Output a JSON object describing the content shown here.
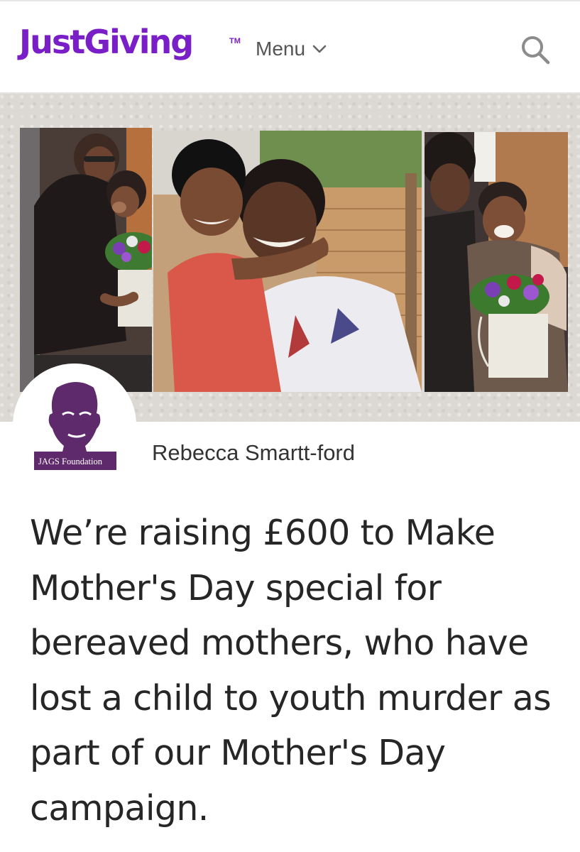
{
  "header": {
    "logo_text": "JustGiving",
    "logo_tm": "TM",
    "menu_label": "Menu",
    "menu_icon": "chevron-down-icon",
    "search_icon": "search-icon",
    "brand_color": "#7a1fc7"
  },
  "banner": {
    "photos": [
      {
        "description_id": "photo-left"
      },
      {
        "description_id": "photo-center"
      },
      {
        "description_id": "photo-right"
      }
    ]
  },
  "fundraiser": {
    "avatar_label": "JAGS Foundation",
    "avatar_color": "#5e2a6b",
    "owner_name": "Rebecca Smartt-ford"
  },
  "headline": "We’re raising £600 to Make Mother's Day special for bereaved mothers, who have lost a child to youth murder as part of our Mother's Day campaign."
}
